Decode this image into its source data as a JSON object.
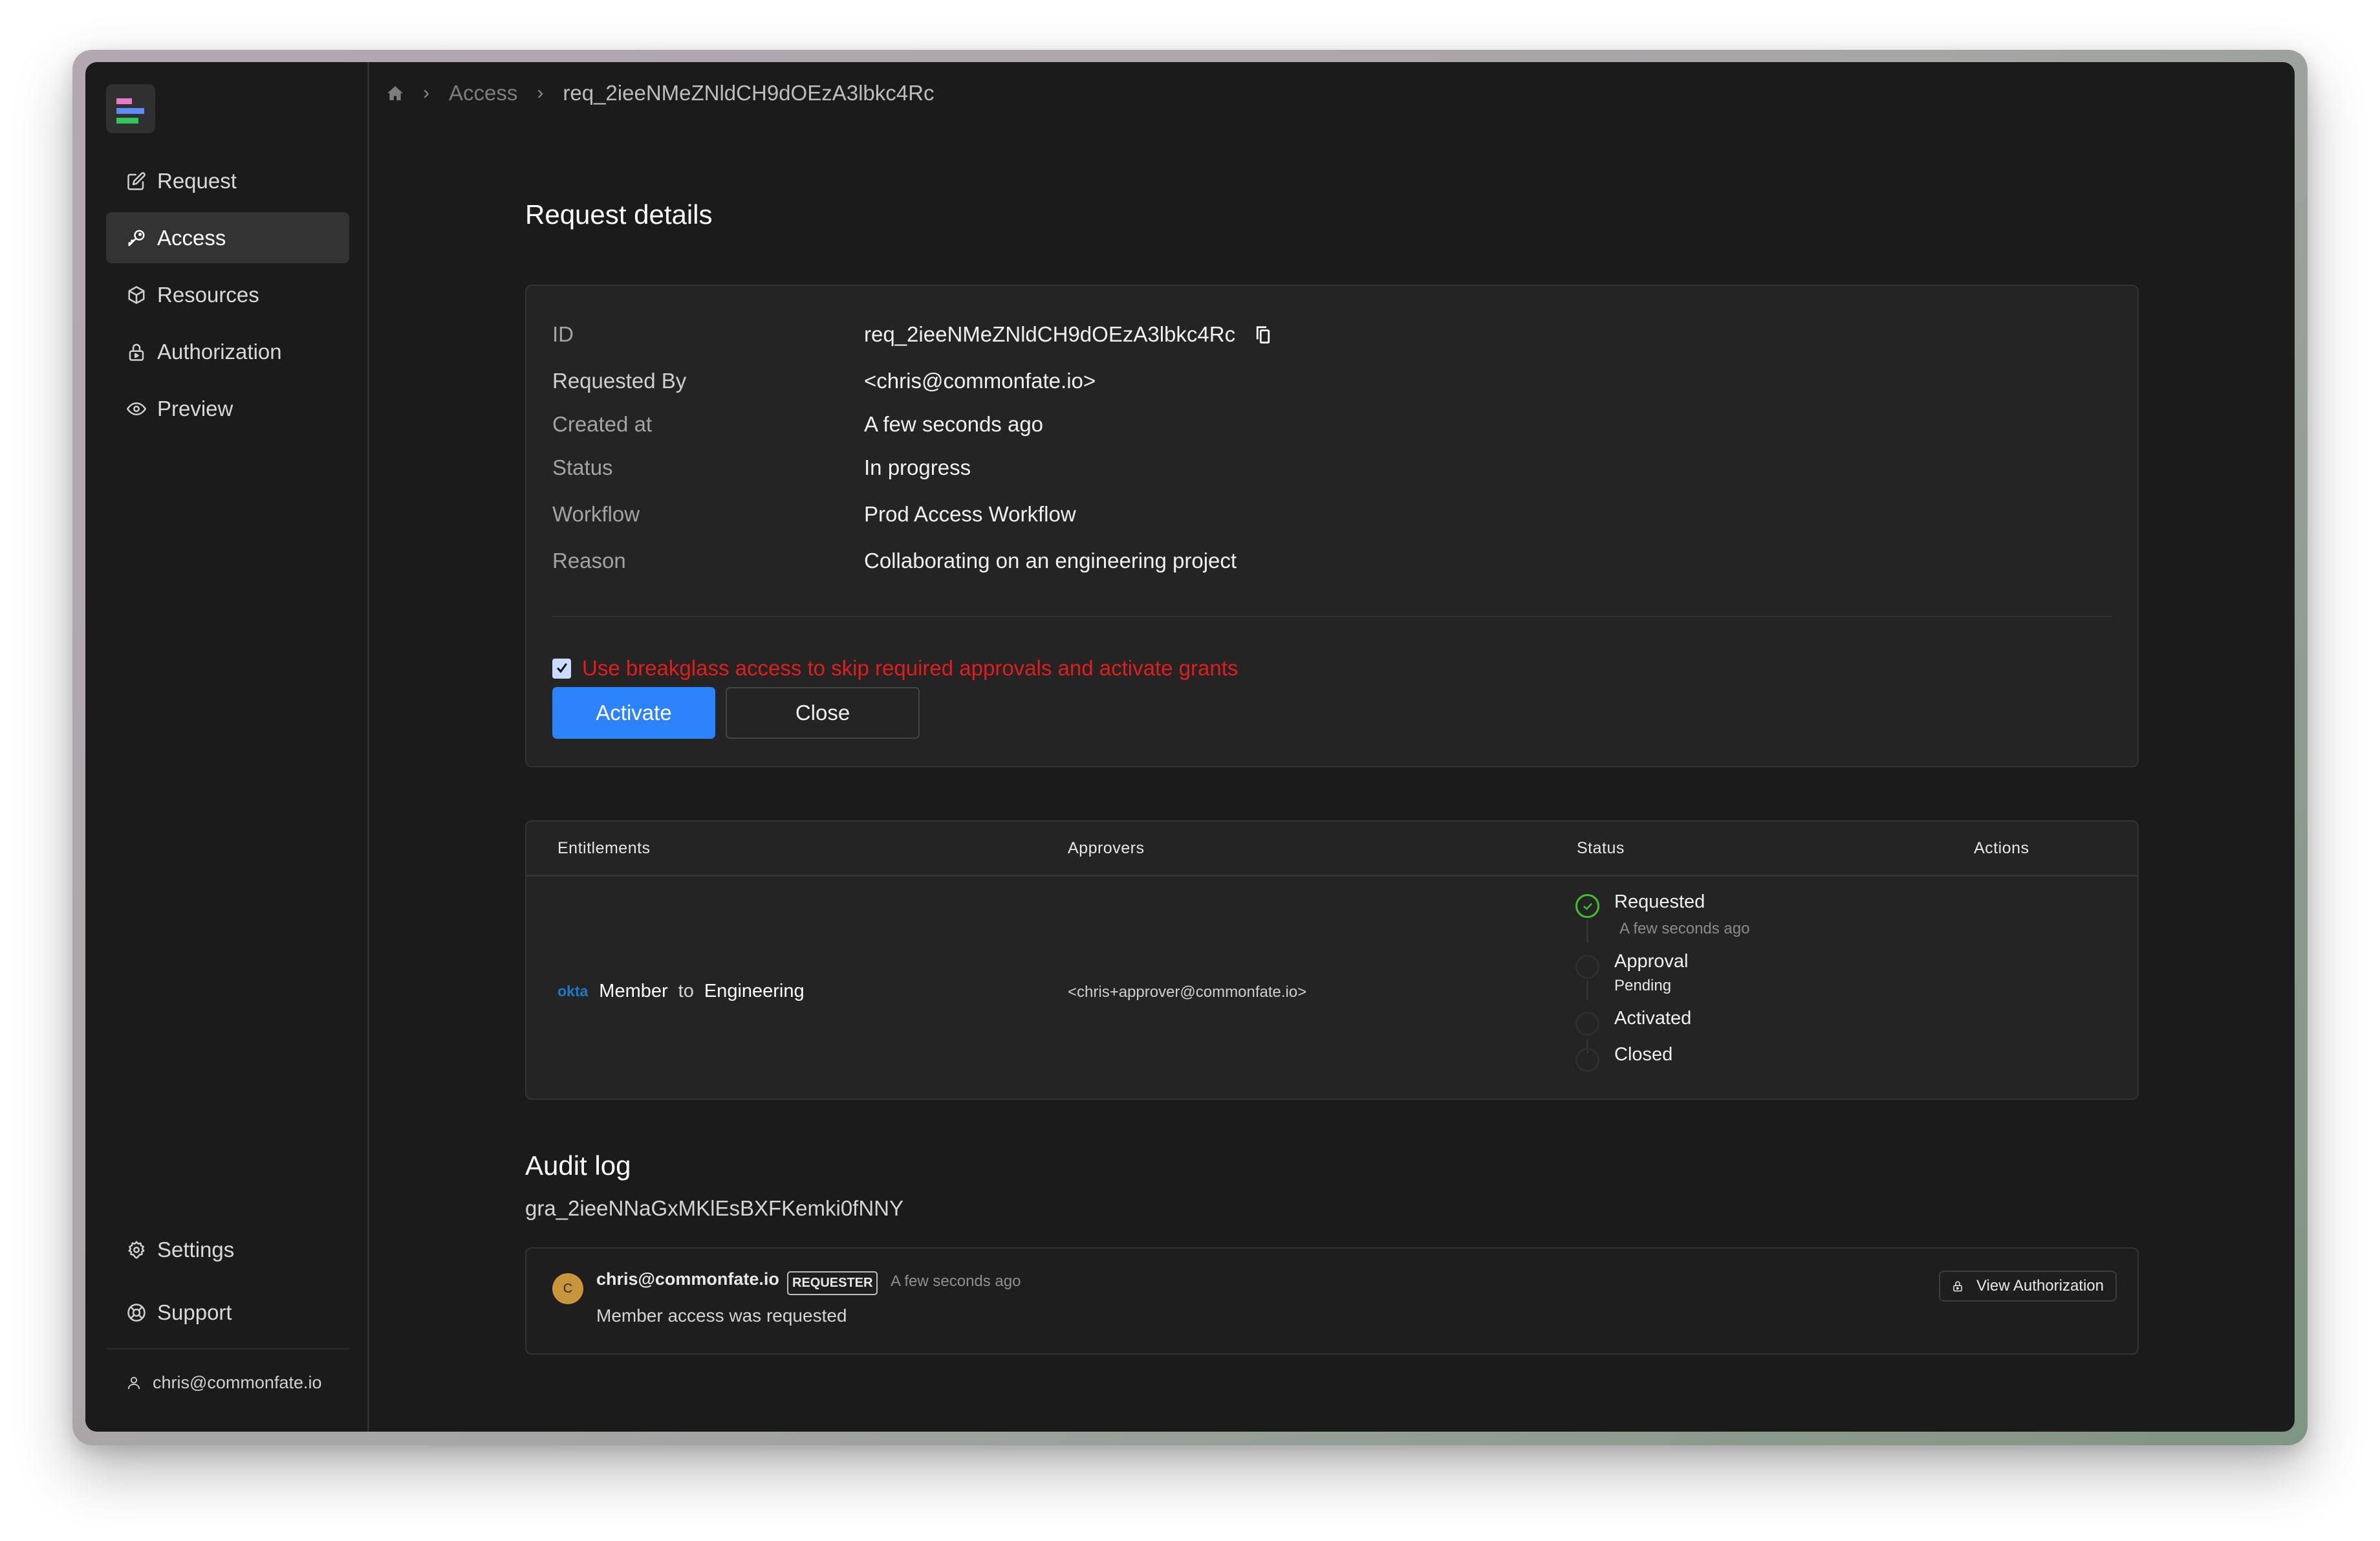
{
  "sidebar": {
    "logo_colors": [
      "#e47bcb",
      "#5b8ef7",
      "#2fc55a"
    ],
    "nav": [
      {
        "label": "Request",
        "icon": "edit-icon",
        "active": false
      },
      {
        "label": "Access",
        "icon": "key-icon",
        "active": true
      },
      {
        "label": "Resources",
        "icon": "cube-icon",
        "active": false
      },
      {
        "label": "Authorization",
        "icon": "lock-icon",
        "active": false
      },
      {
        "label": "Preview",
        "icon": "eye-icon",
        "active": false
      }
    ],
    "bottom": [
      {
        "label": "Settings",
        "icon": "gear-icon"
      },
      {
        "label": "Support",
        "icon": "lifebuoy-icon"
      }
    ],
    "user_email": "chris@commonfate.io"
  },
  "breadcrumb": {
    "home_icon": "home-icon",
    "items": [
      "Access",
      "req_2ieeNMeZNldCH9dOEzA3lbkc4Rc"
    ]
  },
  "request_details": {
    "title": "Request details",
    "fields": [
      {
        "label": "ID",
        "value": "req_2ieeNMeZNldCH9dOEzA3lbkc4Rc"
      },
      {
        "label": "Requested By",
        "value": "<chris@commonfate.io>"
      },
      {
        "label": "Created at",
        "value": "A few seconds ago"
      },
      {
        "label": "Status",
        "value": "In progress"
      },
      {
        "label": "Workflow",
        "value": "Prod Access Workflow"
      },
      {
        "label": "Reason",
        "value": "Collaborating on an engineering project"
      }
    ],
    "breakglass": {
      "checked": true,
      "label": "Use breakglass access to skip required approvals and activate grants",
      "color": "#e01e1e"
    },
    "activate_label": "Activate",
    "close_label": "Close",
    "accent": "#2d83fb"
  },
  "entitlements_table": {
    "headers": [
      "Entitlements",
      "Approvers",
      "Status",
      "Actions"
    ],
    "rows": [
      {
        "provider": "okta",
        "role": "Member",
        "connector": "to",
        "target": "Engineering",
        "approvers": "<chris+approver@commonfate.io>",
        "timeline": [
          {
            "label": "Requested",
            "sub": "A few seconds ago",
            "done": true
          },
          {
            "label": "Approval",
            "sub": "Pending",
            "done": false
          },
          {
            "label": "Activated",
            "sub": "",
            "done": false
          },
          {
            "label": "Closed",
            "sub": "",
            "done": false
          }
        ]
      }
    ]
  },
  "audit_log": {
    "title": "Audit log",
    "grant_id": "gra_2ieeNNaGxMKlEsBXFKemki0fNNY",
    "entries": [
      {
        "avatar_initial": "C",
        "user": "chris@commonfate.io",
        "badge": "REQUESTER",
        "time": "A few seconds ago",
        "message": "Member access was requested",
        "action_label": "View Authorization"
      }
    ]
  }
}
